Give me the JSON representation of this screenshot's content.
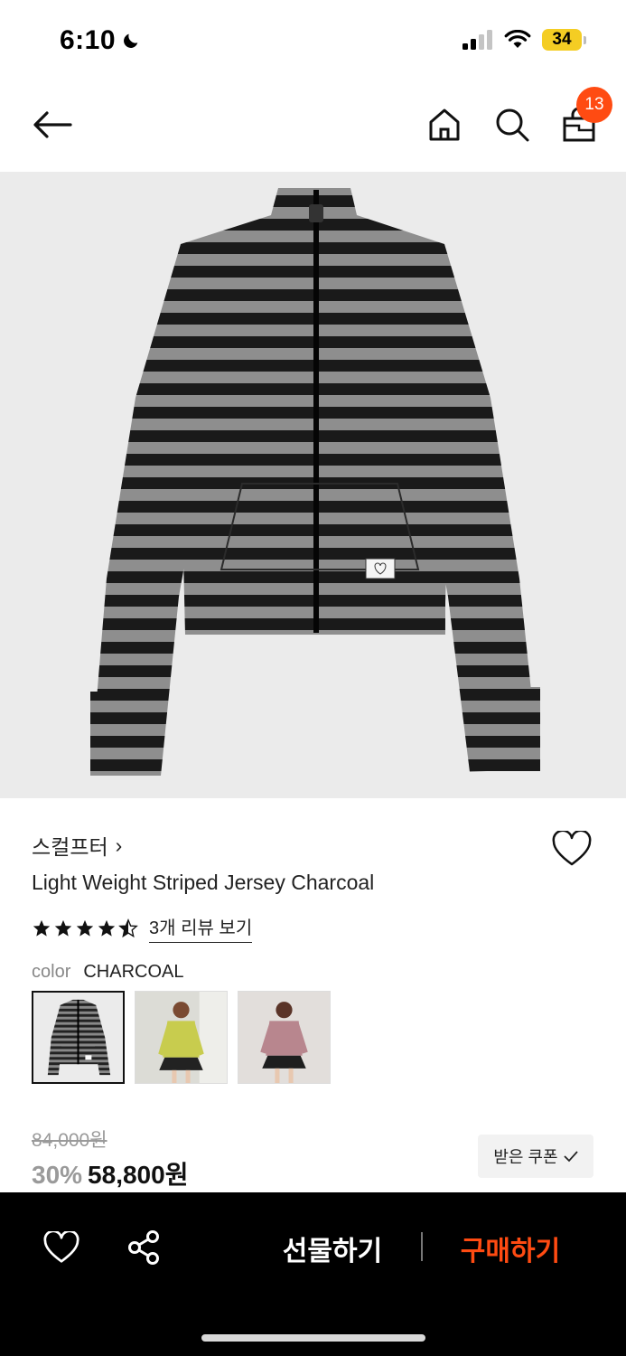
{
  "status_bar": {
    "time": "6:10",
    "battery": "34"
  },
  "nav": {
    "cart_count": "13",
    "icons": [
      "back-arrow-icon",
      "home-icon",
      "search-icon",
      "shopping-bag-icon"
    ]
  },
  "product": {
    "brand": "스컬프터",
    "brand_chevron": "›",
    "name": "Light Weight Striped Jersey Charcoal",
    "rating": 4.5,
    "review_link": "3개 리뷰 보기",
    "color_label": "color",
    "color_value": "CHARCOAL",
    "swatches": [
      "jacket-flat",
      "model-yellow",
      "model-pink"
    ],
    "price_original": "84,000원",
    "discount": "30%",
    "price_final": "58,800원",
    "coupon_label": "받은 쿠폰"
  },
  "bottom_bar": {
    "gift_label": "선물하기",
    "buy_label": "구매하기"
  },
  "colors": {
    "accent": "#ff4b12",
    "battery": "#f4cd23",
    "image_bg": "#ebebeb",
    "bar_bg": "#000000"
  }
}
